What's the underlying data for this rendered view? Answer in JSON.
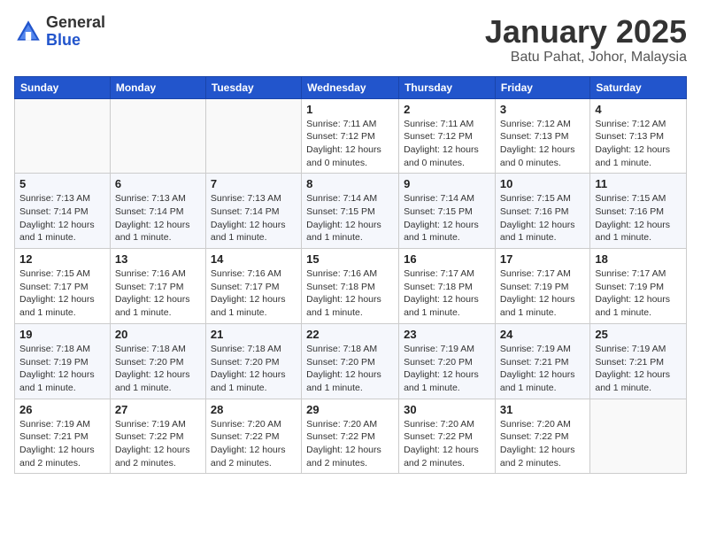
{
  "header": {
    "logo_general": "General",
    "logo_blue": "Blue",
    "title": "January 2025",
    "subtitle": "Batu Pahat, Johor, Malaysia"
  },
  "weekdays": [
    "Sunday",
    "Monday",
    "Tuesday",
    "Wednesday",
    "Thursday",
    "Friday",
    "Saturday"
  ],
  "weeks": [
    [
      {
        "day": "",
        "info": ""
      },
      {
        "day": "",
        "info": ""
      },
      {
        "day": "",
        "info": ""
      },
      {
        "day": "1",
        "info": "Sunrise: 7:11 AM\nSunset: 7:12 PM\nDaylight: 12 hours\nand 0 minutes."
      },
      {
        "day": "2",
        "info": "Sunrise: 7:11 AM\nSunset: 7:12 PM\nDaylight: 12 hours\nand 0 minutes."
      },
      {
        "day": "3",
        "info": "Sunrise: 7:12 AM\nSunset: 7:13 PM\nDaylight: 12 hours\nand 0 minutes."
      },
      {
        "day": "4",
        "info": "Sunrise: 7:12 AM\nSunset: 7:13 PM\nDaylight: 12 hours\nand 1 minute."
      }
    ],
    [
      {
        "day": "5",
        "info": "Sunrise: 7:13 AM\nSunset: 7:14 PM\nDaylight: 12 hours\nand 1 minute."
      },
      {
        "day": "6",
        "info": "Sunrise: 7:13 AM\nSunset: 7:14 PM\nDaylight: 12 hours\nand 1 minute."
      },
      {
        "day": "7",
        "info": "Sunrise: 7:13 AM\nSunset: 7:14 PM\nDaylight: 12 hours\nand 1 minute."
      },
      {
        "day": "8",
        "info": "Sunrise: 7:14 AM\nSunset: 7:15 PM\nDaylight: 12 hours\nand 1 minute."
      },
      {
        "day": "9",
        "info": "Sunrise: 7:14 AM\nSunset: 7:15 PM\nDaylight: 12 hours\nand 1 minute."
      },
      {
        "day": "10",
        "info": "Sunrise: 7:15 AM\nSunset: 7:16 PM\nDaylight: 12 hours\nand 1 minute."
      },
      {
        "day": "11",
        "info": "Sunrise: 7:15 AM\nSunset: 7:16 PM\nDaylight: 12 hours\nand 1 minute."
      }
    ],
    [
      {
        "day": "12",
        "info": "Sunrise: 7:15 AM\nSunset: 7:17 PM\nDaylight: 12 hours\nand 1 minute."
      },
      {
        "day": "13",
        "info": "Sunrise: 7:16 AM\nSunset: 7:17 PM\nDaylight: 12 hours\nand 1 minute."
      },
      {
        "day": "14",
        "info": "Sunrise: 7:16 AM\nSunset: 7:17 PM\nDaylight: 12 hours\nand 1 minute."
      },
      {
        "day": "15",
        "info": "Sunrise: 7:16 AM\nSunset: 7:18 PM\nDaylight: 12 hours\nand 1 minute."
      },
      {
        "day": "16",
        "info": "Sunrise: 7:17 AM\nSunset: 7:18 PM\nDaylight: 12 hours\nand 1 minute."
      },
      {
        "day": "17",
        "info": "Sunrise: 7:17 AM\nSunset: 7:19 PM\nDaylight: 12 hours\nand 1 minute."
      },
      {
        "day": "18",
        "info": "Sunrise: 7:17 AM\nSunset: 7:19 PM\nDaylight: 12 hours\nand 1 minute."
      }
    ],
    [
      {
        "day": "19",
        "info": "Sunrise: 7:18 AM\nSunset: 7:19 PM\nDaylight: 12 hours\nand 1 minute."
      },
      {
        "day": "20",
        "info": "Sunrise: 7:18 AM\nSunset: 7:20 PM\nDaylight: 12 hours\nand 1 minute."
      },
      {
        "day": "21",
        "info": "Sunrise: 7:18 AM\nSunset: 7:20 PM\nDaylight: 12 hours\nand 1 minute."
      },
      {
        "day": "22",
        "info": "Sunrise: 7:18 AM\nSunset: 7:20 PM\nDaylight: 12 hours\nand 1 minute."
      },
      {
        "day": "23",
        "info": "Sunrise: 7:19 AM\nSunset: 7:20 PM\nDaylight: 12 hours\nand 1 minute."
      },
      {
        "day": "24",
        "info": "Sunrise: 7:19 AM\nSunset: 7:21 PM\nDaylight: 12 hours\nand 1 minute."
      },
      {
        "day": "25",
        "info": "Sunrise: 7:19 AM\nSunset: 7:21 PM\nDaylight: 12 hours\nand 1 minute."
      }
    ],
    [
      {
        "day": "26",
        "info": "Sunrise: 7:19 AM\nSunset: 7:21 PM\nDaylight: 12 hours\nand 2 minutes."
      },
      {
        "day": "27",
        "info": "Sunrise: 7:19 AM\nSunset: 7:22 PM\nDaylight: 12 hours\nand 2 minutes."
      },
      {
        "day": "28",
        "info": "Sunrise: 7:20 AM\nSunset: 7:22 PM\nDaylight: 12 hours\nand 2 minutes."
      },
      {
        "day": "29",
        "info": "Sunrise: 7:20 AM\nSunset: 7:22 PM\nDaylight: 12 hours\nand 2 minutes."
      },
      {
        "day": "30",
        "info": "Sunrise: 7:20 AM\nSunset: 7:22 PM\nDaylight: 12 hours\nand 2 minutes."
      },
      {
        "day": "31",
        "info": "Sunrise: 7:20 AM\nSunset: 7:22 PM\nDaylight: 12 hours\nand 2 minutes."
      },
      {
        "day": "",
        "info": ""
      }
    ]
  ]
}
